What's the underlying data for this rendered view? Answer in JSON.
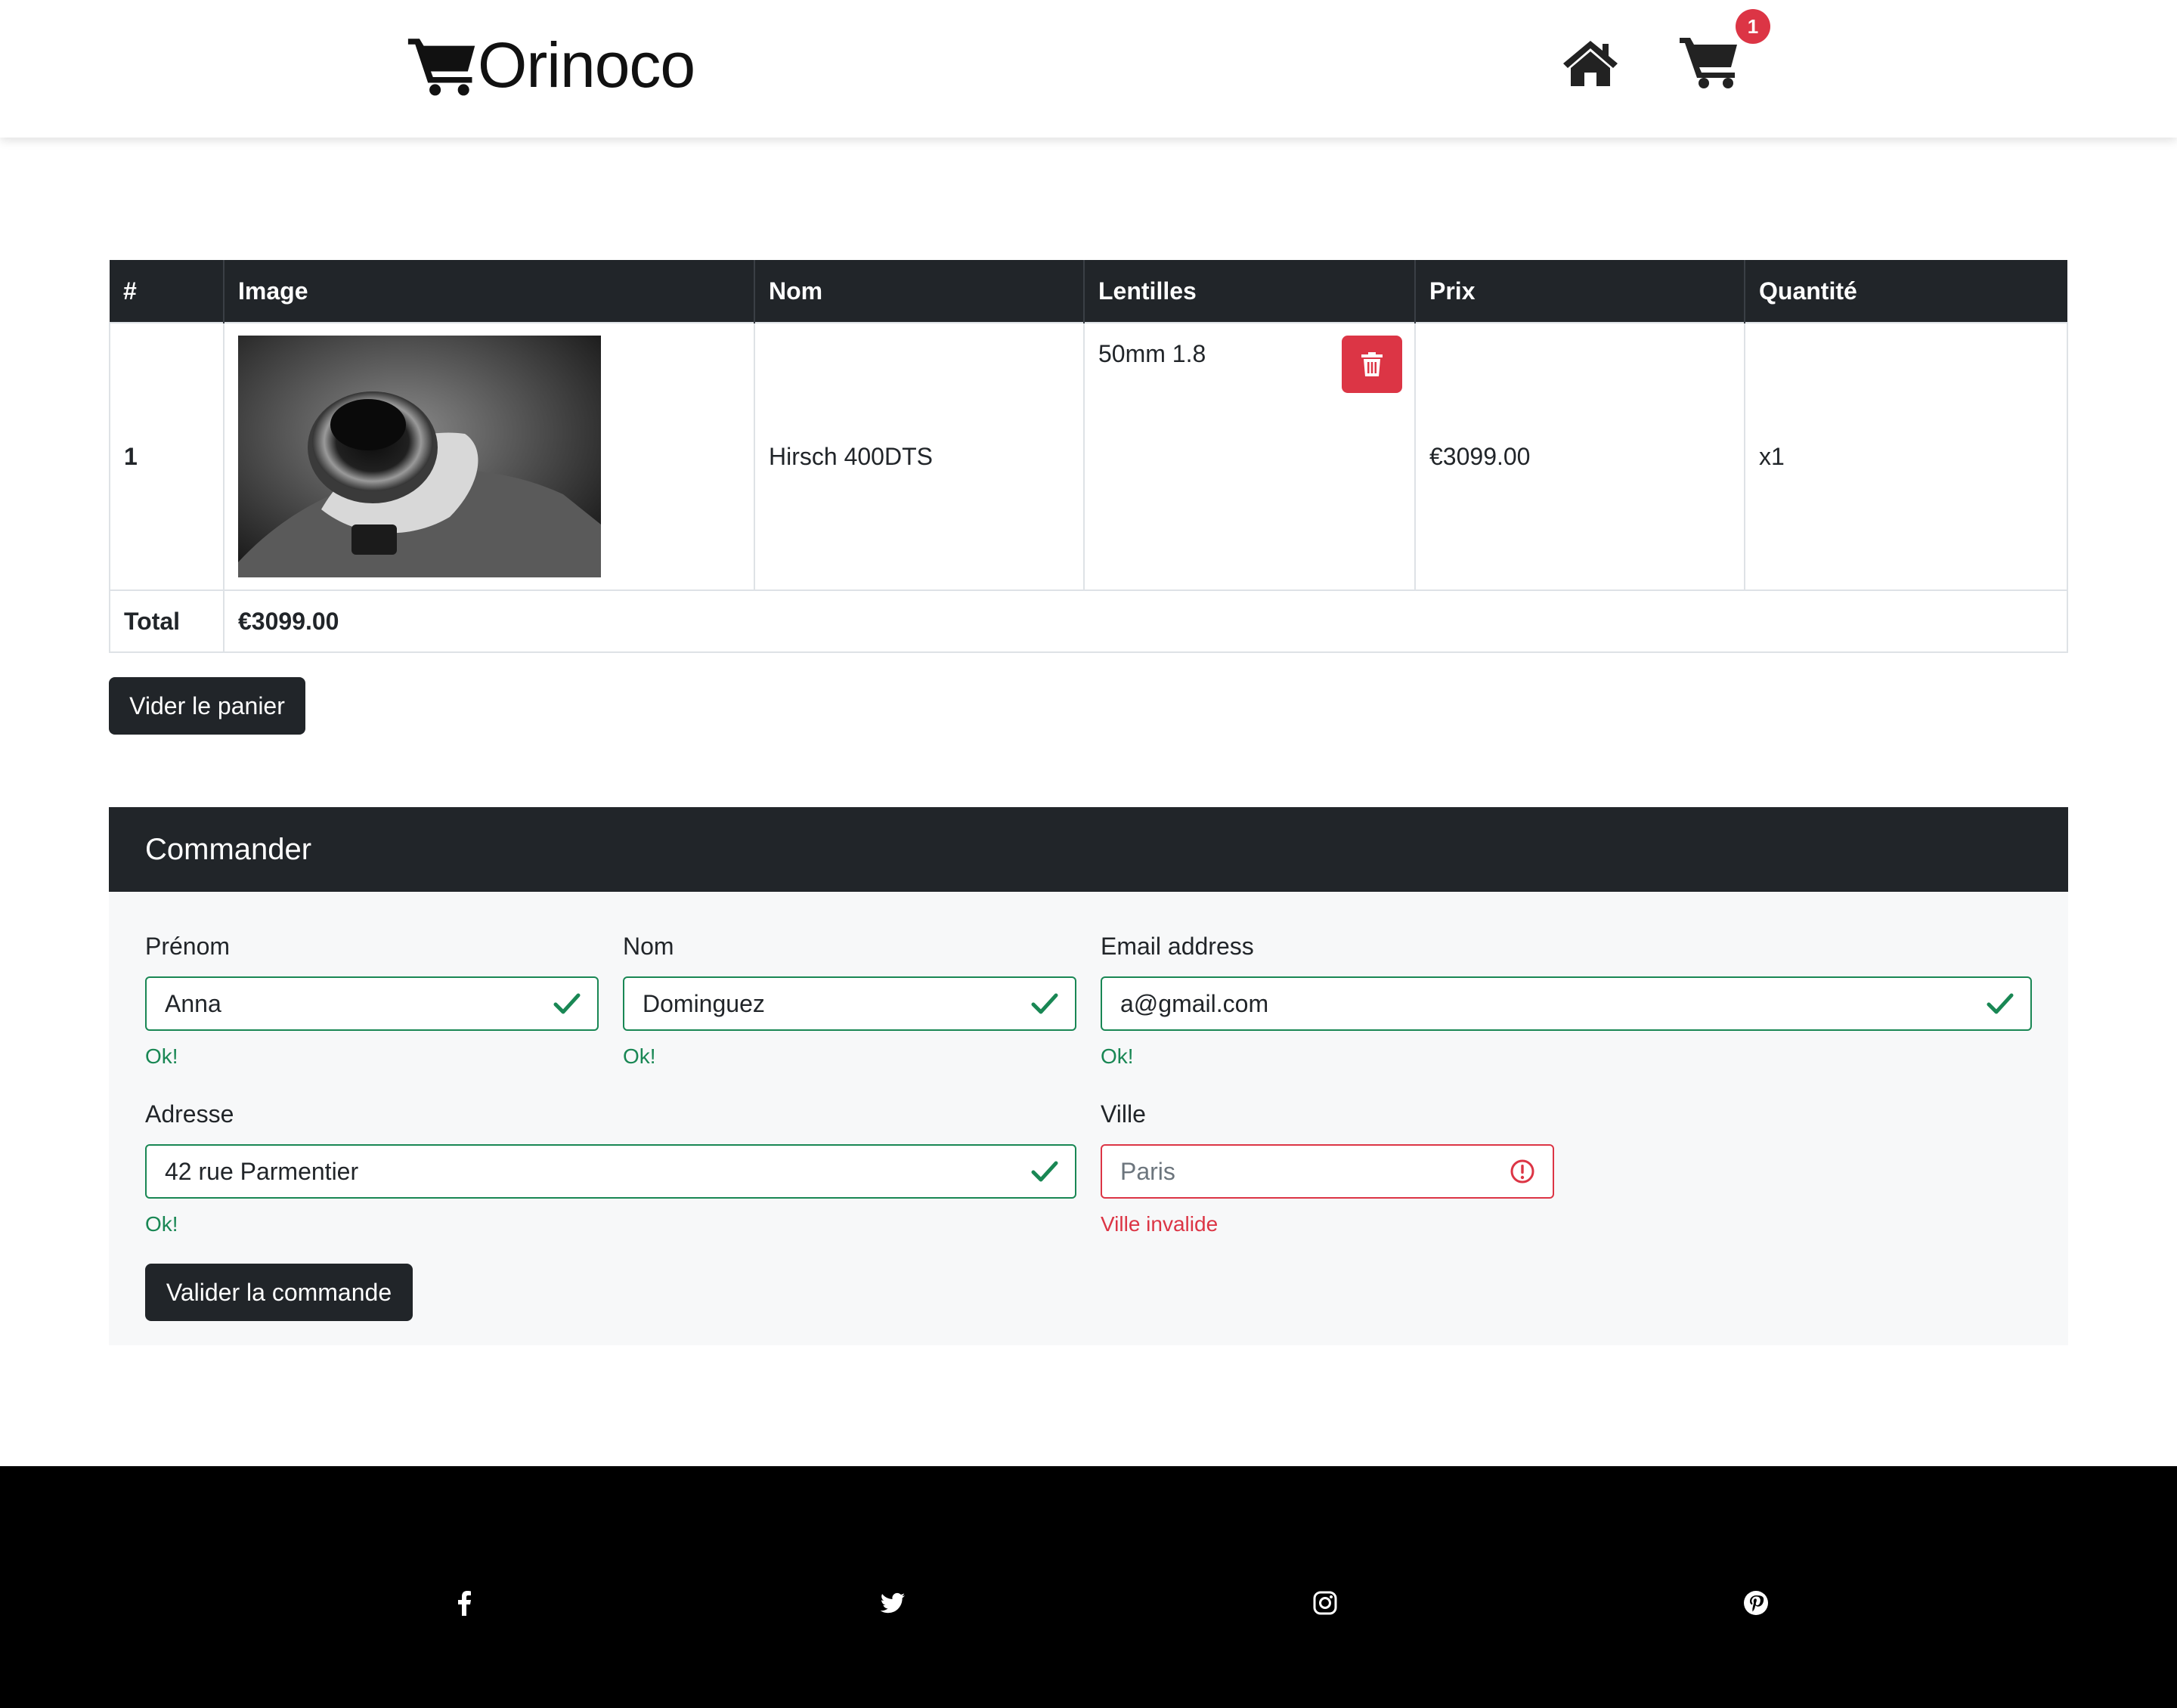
{
  "header": {
    "brand": "Orinoco",
    "cart_count": "1"
  },
  "cart_table": {
    "columns": [
      "#",
      "Image",
      "Nom",
      "Lentilles",
      "Prix",
      "Quantité"
    ],
    "rows": [
      {
        "index": "1",
        "name": "Hirsch 400DTS",
        "lens": "50mm 1.8",
        "price": "€3099.00",
        "quantity": "x1"
      }
    ],
    "total_label": "Total",
    "total_value": "€3099.00"
  },
  "empty_cart_label": "Vider le panier",
  "order": {
    "title": "Commander",
    "fields": {
      "prenom": {
        "label": "Prénom",
        "value": "Anna",
        "feedback": "Ok!"
      },
      "nom": {
        "label": "Nom",
        "value": "Dominguez",
        "feedback": "Ok!"
      },
      "email": {
        "label": "Email address",
        "value": "a@gmail.com",
        "feedback": "Ok!"
      },
      "adresse": {
        "label": "Adresse",
        "value": "42 rue Parmentier",
        "feedback": "Ok!"
      },
      "ville": {
        "label": "Ville",
        "placeholder": "Paris",
        "feedback": "Ville invalide"
      }
    },
    "submit_label": "Valider la commande"
  },
  "footer": {
    "social_icons": [
      "facebook-icon",
      "twitter-icon",
      "instagram-icon",
      "pinterest-icon"
    ]
  },
  "colors": {
    "dark": "#212529",
    "danger": "#dc3545",
    "success": "#198754",
    "card_bg": "#f7f8f9",
    "footer_bg": "#000000"
  }
}
